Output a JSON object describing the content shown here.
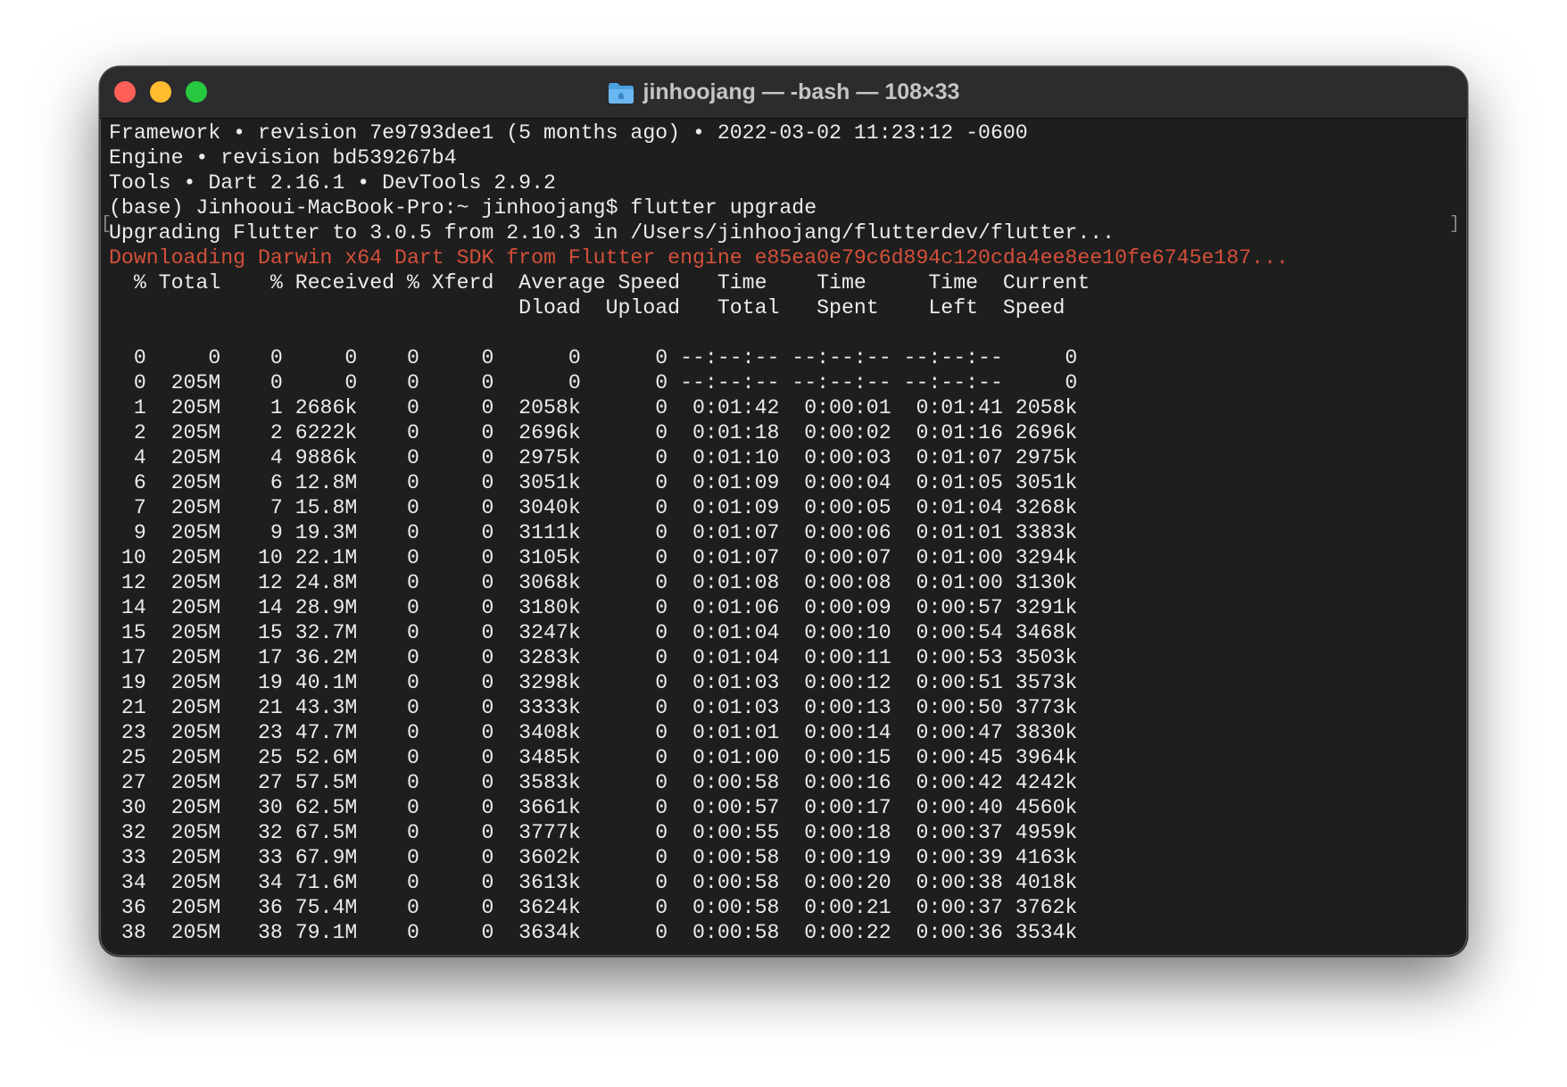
{
  "window": {
    "title": "jinhoojang — -bash — 108×33",
    "title_icon": "folder-icon",
    "colors": {
      "background": "#1e1e1e",
      "titlebar": "#2c2c2e",
      "text": "#ececec",
      "error_text": "#d4503a",
      "close": "#fe5f57",
      "minimize": "#febc2e",
      "maximize": "#28c840"
    }
  },
  "terminal": {
    "lines": [
      {
        "text": "Framework • revision 7e9793dee1 (5 months ago) • 2022-03-02 11:23:12 -0600",
        "style": "normal"
      },
      {
        "text": "Engine • revision bd539267b4",
        "style": "normal"
      },
      {
        "text": "Tools • Dart 2.16.1 • DevTools 2.9.2",
        "style": "normal"
      },
      {
        "text": "(base) Jinhooui-MacBook-Pro:~ jinhoojang$ flutter upgrade",
        "style": "normal"
      },
      {
        "text": "Upgrading Flutter to 3.0.5 from 2.10.3 in /Users/jinhoojang/flutterdev/flutter...",
        "style": "normal"
      },
      {
        "text": "Downloading Darwin x64 Dart SDK from Flutter engine e85ea0e79c6d894c120cda4ee8ee10fe6745e187...",
        "style": "err"
      },
      {
        "text": "  % Total    % Received % Xferd  Average Speed   Time    Time     Time  Current",
        "style": "normal"
      },
      {
        "text": "                                 Dload  Upload   Total   Spent    Left  Speed",
        "style": "normal"
      },
      {
        "text": "",
        "style": "normal"
      },
      {
        "text": "  0     0    0     0    0     0      0      0 --:--:-- --:--:-- --:--:--     0",
        "style": "normal"
      },
      {
        "text": "  0  205M    0     0    0     0      0      0 --:--:-- --:--:-- --:--:--     0",
        "style": "normal"
      },
      {
        "text": "  1  205M    1 2686k    0     0  2058k      0  0:01:42  0:00:01  0:01:41 2058k",
        "style": "normal"
      },
      {
        "text": "  2  205M    2 6222k    0     0  2696k      0  0:01:18  0:00:02  0:01:16 2696k",
        "style": "normal"
      },
      {
        "text": "  4  205M    4 9886k    0     0  2975k      0  0:01:10  0:00:03  0:01:07 2975k",
        "style": "normal"
      },
      {
        "text": "  6  205M    6 12.8M    0     0  3051k      0  0:01:09  0:00:04  0:01:05 3051k",
        "style": "normal"
      },
      {
        "text": "  7  205M    7 15.8M    0     0  3040k      0  0:01:09  0:00:05  0:01:04 3268k",
        "style": "normal"
      },
      {
        "text": "  9  205M    9 19.3M    0     0  3111k      0  0:01:07  0:00:06  0:01:01 3383k",
        "style": "normal"
      },
      {
        "text": " 10  205M   10 22.1M    0     0  3105k      0  0:01:07  0:00:07  0:01:00 3294k",
        "style": "normal"
      },
      {
        "text": " 12  205M   12 24.8M    0     0  3068k      0  0:01:08  0:00:08  0:01:00 3130k",
        "style": "normal"
      },
      {
        "text": " 14  205M   14 28.9M    0     0  3180k      0  0:01:06  0:00:09  0:00:57 3291k",
        "style": "normal"
      },
      {
        "text": " 15  205M   15 32.7M    0     0  3247k      0  0:01:04  0:00:10  0:00:54 3468k",
        "style": "normal"
      },
      {
        "text": " 17  205M   17 36.2M    0     0  3283k      0  0:01:04  0:00:11  0:00:53 3503k",
        "style": "normal"
      },
      {
        "text": " 19  205M   19 40.1M    0     0  3298k      0  0:01:03  0:00:12  0:00:51 3573k",
        "style": "normal"
      },
      {
        "text": " 21  205M   21 43.3M    0     0  3333k      0  0:01:03  0:00:13  0:00:50 3773k",
        "style": "normal"
      },
      {
        "text": " 23  205M   23 47.7M    0     0  3408k      0  0:01:01  0:00:14  0:00:47 3830k",
        "style": "normal"
      },
      {
        "text": " 25  205M   25 52.6M    0     0  3485k      0  0:01:00  0:00:15  0:00:45 3964k",
        "style": "normal"
      },
      {
        "text": " 27  205M   27 57.5M    0     0  3583k      0  0:00:58  0:00:16  0:00:42 4242k",
        "style": "normal"
      },
      {
        "text": " 30  205M   30 62.5M    0     0  3661k      0  0:00:57  0:00:17  0:00:40 4560k",
        "style": "normal"
      },
      {
        "text": " 32  205M   32 67.5M    0     0  3777k      0  0:00:55  0:00:18  0:00:37 4959k",
        "style": "normal"
      },
      {
        "text": " 33  205M   33 67.9M    0     0  3602k      0  0:00:58  0:00:19  0:00:39 4163k",
        "style": "normal"
      },
      {
        "text": " 34  205M   34 71.6M    0     0  3613k      0  0:00:58  0:00:20  0:00:38 4018k",
        "style": "normal"
      },
      {
        "text": " 36  205M   36 75.4M    0     0  3624k      0  0:00:58  0:00:21  0:00:37 3762k",
        "style": "normal"
      },
      {
        "text": " 38  205M   38 79.1M    0     0  3634k      0  0:00:58  0:00:22  0:00:36 3534k",
        "style": "normal"
      }
    ],
    "selection_brackets": {
      "left": "[",
      "right": "]"
    }
  }
}
